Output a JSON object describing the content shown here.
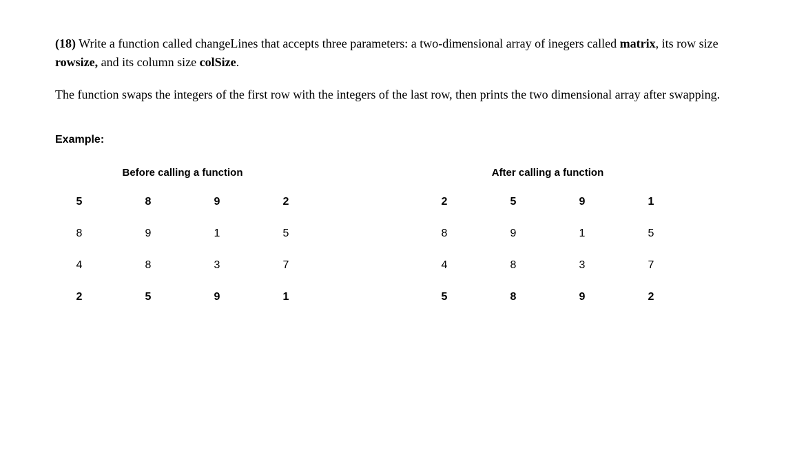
{
  "question": {
    "number": "(18)",
    "text_part1": " Write a function called changeLines that accepts three parameters: a two-dimensional array of inegers called ",
    "kw_matrix": "matrix",
    "text_part2": ", its row size ",
    "kw_rowsize": "rowsize,",
    "text_part3": " and its column size ",
    "kw_colsize": "colSize",
    "text_part4": "."
  },
  "description": "The function swaps the integers of the first row with the integers of the last row, then prints the two dimensional array after swapping.",
  "example_label": "Example:",
  "before": {
    "caption": "Before calling a function",
    "rows": [
      [
        "5",
        "8",
        "9",
        "2"
      ],
      [
        "8",
        "9",
        "1",
        "5"
      ],
      [
        "4",
        "8",
        "3",
        "7"
      ],
      [
        "2",
        "5",
        "9",
        "1"
      ]
    ]
  },
  "after": {
    "caption": "After calling a function",
    "rows": [
      [
        "2",
        "5",
        "9",
        "1"
      ],
      [
        "8",
        "9",
        "1",
        "5"
      ],
      [
        "4",
        "8",
        "3",
        "7"
      ],
      [
        "5",
        "8",
        "9",
        "2"
      ]
    ]
  }
}
